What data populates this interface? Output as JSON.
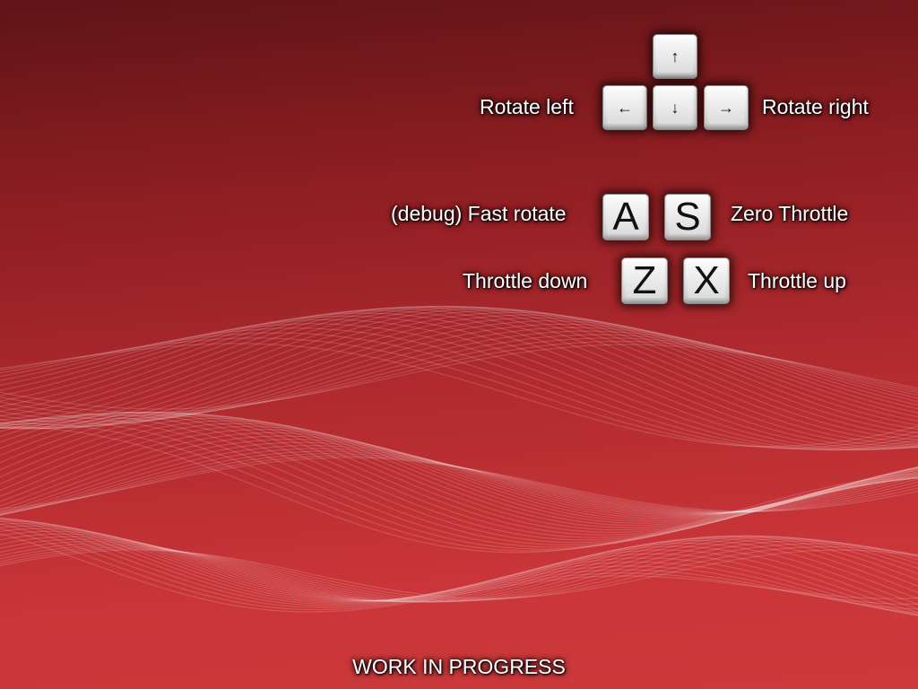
{
  "controls": {
    "rotate_left": "Rotate left",
    "rotate_right": "Rotate right",
    "fast_rotate": "(debug) Fast rotate",
    "zero_throttle": "Zero Throttle",
    "throttle_down": "Throttle down",
    "throttle_up": "Throttle up"
  },
  "keys": {
    "up": "↑",
    "left": "←",
    "down": "↓",
    "right": "→",
    "a": "A",
    "s": "S",
    "z": "Z",
    "x": "X"
  },
  "footer": "WORK IN PROGRESS",
  "colors": {
    "background_top": "#5e1417",
    "background_bottom": "#cc3a3c",
    "text": "#ffffff",
    "key": "#e6e6e6"
  }
}
